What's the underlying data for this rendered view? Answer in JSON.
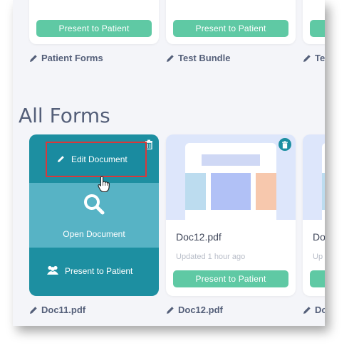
{
  "top_row": {
    "cards": [
      {
        "button": "Present to Patient",
        "name_label": "Patient Forms"
      },
      {
        "button": "Present to Patient",
        "name_label": "Test Bundle"
      },
      {
        "button": "",
        "name_label": "Tes"
      }
    ]
  },
  "section": {
    "title": "All Forms"
  },
  "forms": [
    {
      "name_label": "Doc11.pdf",
      "hover": {
        "edit": "Edit Document",
        "open": "Open Document",
        "present": "Present to Patient"
      }
    },
    {
      "title": "Doc12.pdf",
      "updated": "Updated 1 hour ago",
      "button": "Present to Patient",
      "name_label": "Doc12.pdf"
    },
    {
      "title": "Do",
      "updated": "Up",
      "name_label": "Do"
    }
  ],
  "colors": {
    "accent_green": "#5fc9a4",
    "teal_dark": "#1d8fa1",
    "teal_light": "#57b3c5",
    "highlight_red": "#d9383a",
    "label_text": "#545f79"
  },
  "icons": [
    "pencil-icon",
    "trash-icon",
    "search-icon",
    "users-icon",
    "hand-cursor-icon"
  ]
}
